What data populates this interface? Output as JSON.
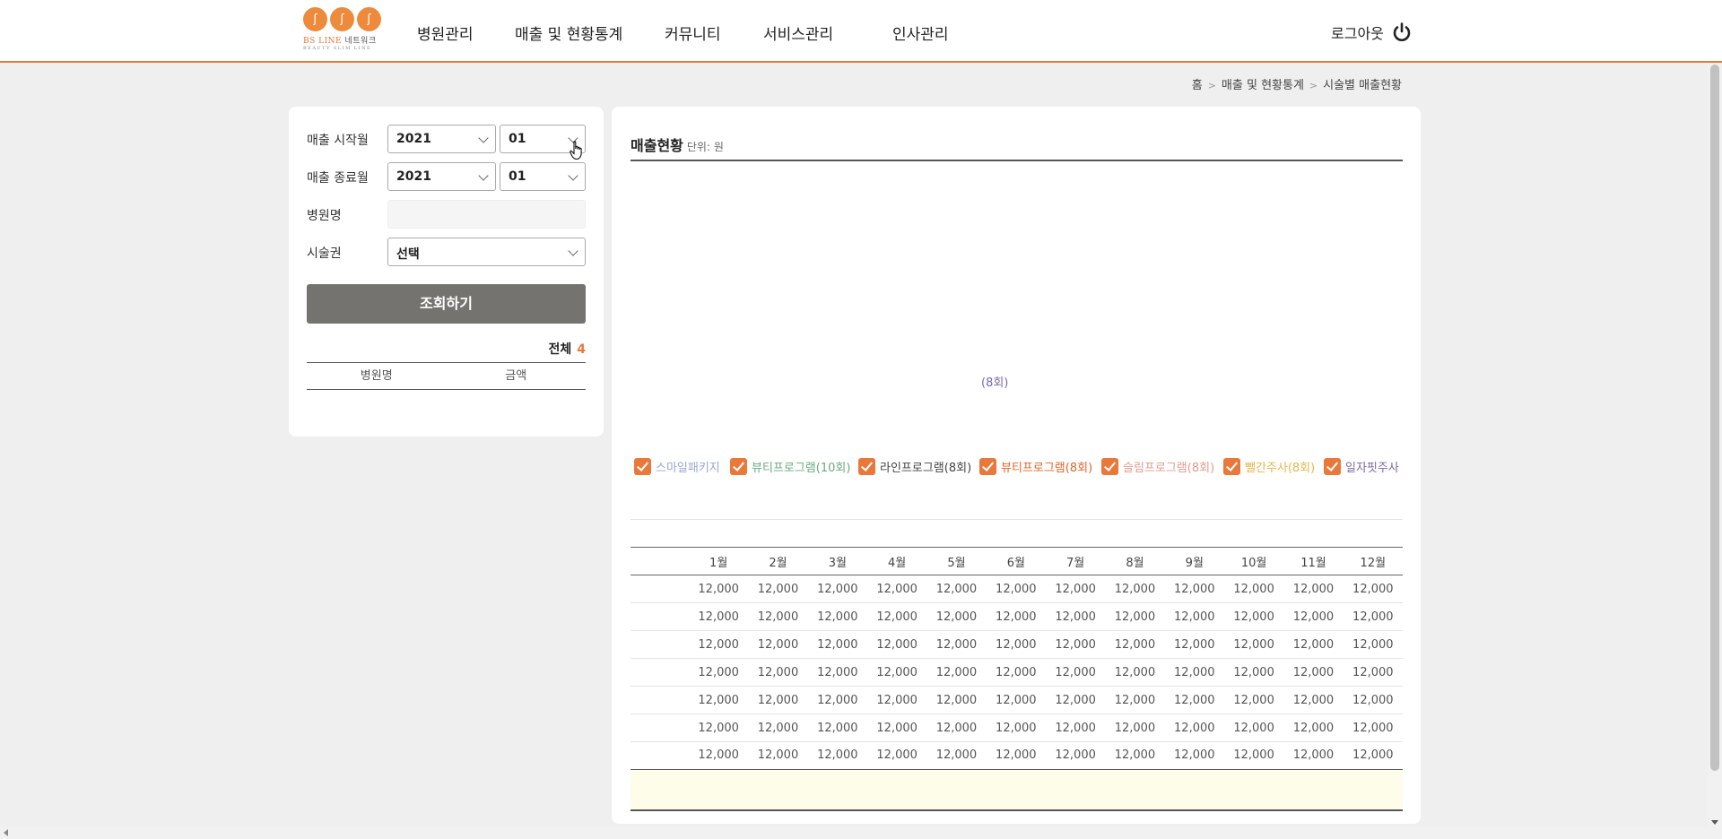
{
  "header": {
    "logo": {
      "brand": "BS LINE",
      "brand_sub": "네트워크",
      "tagline": "BEAUTY SLIM LINE"
    },
    "nav": [
      "병원관리",
      "매출 및 현황통계",
      "커뮤니티",
      "서비스관리",
      "인사관리"
    ],
    "logout_label": "로그아웃"
  },
  "breadcrumb": [
    "홈",
    "매출 및 현황통계",
    "시술별 매출현황"
  ],
  "filters": {
    "start_label": "매출 시작월",
    "start_year": "2021",
    "start_month": "01",
    "end_label": "매출 종료월",
    "end_year": "2021",
    "end_month": "01",
    "hospital_label": "병원명",
    "hospital_value": "",
    "procedure_label": "시술권",
    "procedure_value": "선택",
    "search_label": "조회하기"
  },
  "summary": {
    "total_label": "전체",
    "total_count": "4",
    "columns": [
      "병원명",
      "금액"
    ]
  },
  "panel": {
    "title": "매출현황",
    "unit": "단위: 원"
  },
  "legend": {
    "items": [
      {
        "label": "스마일패키지",
        "color": "#9aa6d6"
      },
      {
        "label": "뷰티프로그램(10회)",
        "color": "#6aaa7f"
      },
      {
        "label": "라인프로그램(8회)",
        "color": "#444444"
      },
      {
        "label": "뷰티프로그램(8회)",
        "color": "#e0662a"
      },
      {
        "label": "슬림프로그램(8회)",
        "color": "#e39a90"
      },
      {
        "label": "뺄간주사(8회)",
        "color": "#e3b84a"
      },
      {
        "label": "일자핏주사",
        "color": "#7a6aa8"
      }
    ],
    "wrap_text": "(8회)"
  },
  "table": {
    "months": [
      "1월",
      "2월",
      "3월",
      "4월",
      "5월",
      "6월",
      "7월",
      "8월",
      "9월",
      "10월",
      "11월",
      "12월"
    ],
    "rows": [
      [
        "12,000",
        "12,000",
        "12,000",
        "12,000",
        "12,000",
        "12,000",
        "12,000",
        "12,000",
        "12,000",
        "12,000",
        "12,000",
        "12,000"
      ],
      [
        "12,000",
        "12,000",
        "12,000",
        "12,000",
        "12,000",
        "12,000",
        "12,000",
        "12,000",
        "12,000",
        "12,000",
        "12,000",
        "12,000"
      ],
      [
        "12,000",
        "12,000",
        "12,000",
        "12,000",
        "12,000",
        "12,000",
        "12,000",
        "12,000",
        "12,000",
        "12,000",
        "12,000",
        "12,000"
      ],
      [
        "12,000",
        "12,000",
        "12,000",
        "12,000",
        "12,000",
        "12,000",
        "12,000",
        "12,000",
        "12,000",
        "12,000",
        "12,000",
        "12,000"
      ],
      [
        "12,000",
        "12,000",
        "12,000",
        "12,000",
        "12,000",
        "12,000",
        "12,000",
        "12,000",
        "12,000",
        "12,000",
        "12,000",
        "12,000"
      ],
      [
        "12,000",
        "12,000",
        "12,000",
        "12,000",
        "12,000",
        "12,000",
        "12,000",
        "12,000",
        "12,000",
        "12,000",
        "12,000",
        "12,000"
      ],
      [
        "12,000",
        "12,000",
        "12,000",
        "12,000",
        "12,000",
        "12,000",
        "12,000",
        "12,000",
        "12,000",
        "12,000",
        "12,000",
        "12,000"
      ]
    ]
  },
  "colors": {
    "accent": "#e8793a",
    "button": "#75736f",
    "total_row": "#fdfdea"
  }
}
